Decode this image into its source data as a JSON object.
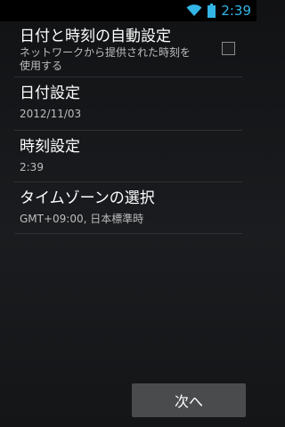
{
  "status_bar": {
    "time": "2:39",
    "wifi_icon": "wifi-icon",
    "battery_icon": "battery-icon",
    "accent_color": "#33b5e5"
  },
  "settings": {
    "auto_datetime": {
      "title": "日付と時刻の自動設定",
      "summary": "ネットワークから提供された時刻を使用する",
      "checked": false
    },
    "date": {
      "title": "日付設定",
      "value": "2012/11/03"
    },
    "time": {
      "title": "時刻設定",
      "value": "2:39"
    },
    "timezone": {
      "title": "タイムゾーンの選択",
      "value": "GMT+09:00, 日本標準時"
    }
  },
  "footer": {
    "next_label": "次へ"
  }
}
